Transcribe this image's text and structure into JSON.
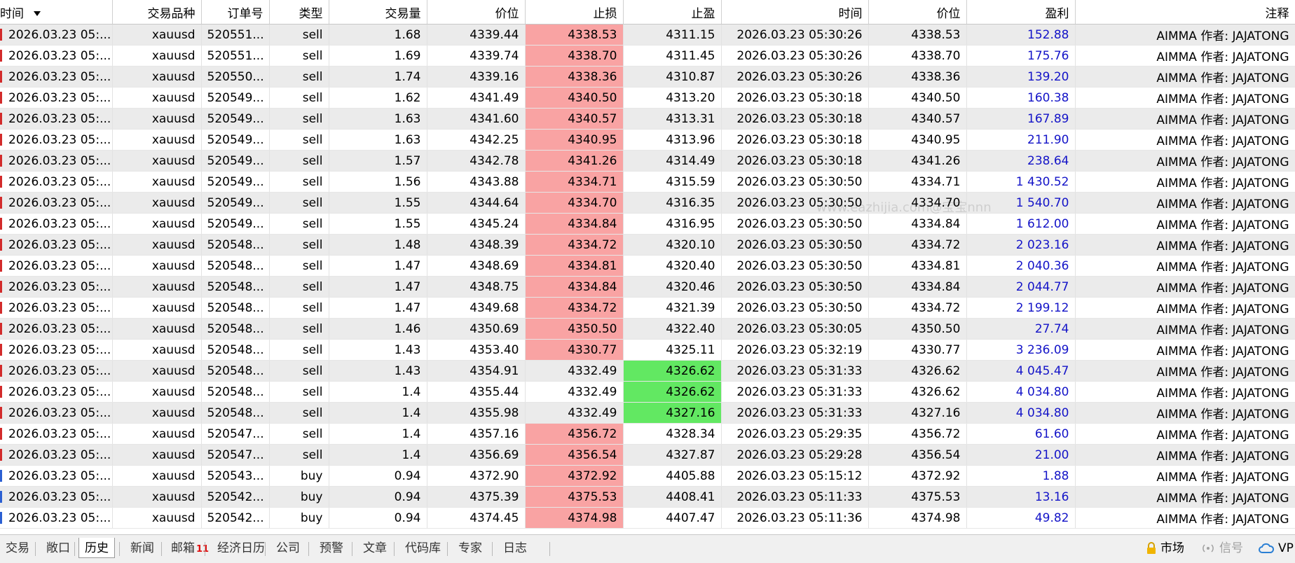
{
  "columns": [
    "时间",
    "交易品种",
    "订单号",
    "类型",
    "交易量",
    "价位",
    "止损",
    "止盈",
    "时间",
    "价位",
    "盈利",
    "注释"
  ],
  "rows": [
    {
      "open_time": "2026.03.23 05:...",
      "symbol": "xauusd",
      "ticket": "520551...",
      "type": "sell",
      "volume": "1.68",
      "open_price": "4339.44",
      "sl": "4338.53",
      "tp": "4311.15",
      "close_time": "2026.03.23 05:30:26",
      "close_price": "4338.53",
      "profit": "152.88",
      "comment": "AIMMA 作者: JAJATONG",
      "sl_hit": true,
      "tp_hit": false
    },
    {
      "open_time": "2026.03.23 05:...",
      "symbol": "xauusd",
      "ticket": "520551...",
      "type": "sell",
      "volume": "1.69",
      "open_price": "4339.74",
      "sl": "4338.70",
      "tp": "4311.45",
      "close_time": "2026.03.23 05:30:26",
      "close_price": "4338.70",
      "profit": "175.76",
      "comment": "AIMMA 作者: JAJATONG",
      "sl_hit": true,
      "tp_hit": false
    },
    {
      "open_time": "2026.03.23 05:...",
      "symbol": "xauusd",
      "ticket": "520550...",
      "type": "sell",
      "volume": "1.74",
      "open_price": "4339.16",
      "sl": "4338.36",
      "tp": "4310.87",
      "close_time": "2026.03.23 05:30:26",
      "close_price": "4338.36",
      "profit": "139.20",
      "comment": "AIMMA 作者: JAJATONG",
      "sl_hit": true,
      "tp_hit": false
    },
    {
      "open_time": "2026.03.23 05:...",
      "symbol": "xauusd",
      "ticket": "520549...",
      "type": "sell",
      "volume": "1.62",
      "open_price": "4341.49",
      "sl": "4340.50",
      "tp": "4313.20",
      "close_time": "2026.03.23 05:30:18",
      "close_price": "4340.50",
      "profit": "160.38",
      "comment": "AIMMA 作者: JAJATONG",
      "sl_hit": true,
      "tp_hit": false
    },
    {
      "open_time": "2026.03.23 05:...",
      "symbol": "xauusd",
      "ticket": "520549...",
      "type": "sell",
      "volume": "1.63",
      "open_price": "4341.60",
      "sl": "4340.57",
      "tp": "4313.31",
      "close_time": "2026.03.23 05:30:18",
      "close_price": "4340.57",
      "profit": "167.89",
      "comment": "AIMMA 作者: JAJATONG",
      "sl_hit": true,
      "tp_hit": false
    },
    {
      "open_time": "2026.03.23 05:...",
      "symbol": "xauusd",
      "ticket": "520549...",
      "type": "sell",
      "volume": "1.63",
      "open_price": "4342.25",
      "sl": "4340.95",
      "tp": "4313.96",
      "close_time": "2026.03.23 05:30:18",
      "close_price": "4340.95",
      "profit": "211.90",
      "comment": "AIMMA 作者: JAJATONG",
      "sl_hit": true,
      "tp_hit": false
    },
    {
      "open_time": "2026.03.23 05:...",
      "symbol": "xauusd",
      "ticket": "520549...",
      "type": "sell",
      "volume": "1.57",
      "open_price": "4342.78",
      "sl": "4341.26",
      "tp": "4314.49",
      "close_time": "2026.03.23 05:30:18",
      "close_price": "4341.26",
      "profit": "238.64",
      "comment": "AIMMA 作者: JAJATONG",
      "sl_hit": true,
      "tp_hit": false
    },
    {
      "open_time": "2026.03.23 05:...",
      "symbol": "xauusd",
      "ticket": "520549...",
      "type": "sell",
      "volume": "1.56",
      "open_price": "4343.88",
      "sl": "4334.71",
      "tp": "4315.59",
      "close_time": "2026.03.23 05:30:50",
      "close_price": "4334.71",
      "profit": "1 430.52",
      "comment": "AIMMA 作者: JAJATONG",
      "sl_hit": true,
      "tp_hit": false
    },
    {
      "open_time": "2026.03.23 05:...",
      "symbol": "xauusd",
      "ticket": "520549...",
      "type": "sell",
      "volume": "1.55",
      "open_price": "4344.64",
      "sl": "4334.70",
      "tp": "4316.35",
      "close_time": "2026.03.23 05:30:50",
      "close_price": "4334.70",
      "profit": "1 540.70",
      "comment": "AIMMA 作者: JAJATONG",
      "sl_hit": true,
      "tp_hit": false
    },
    {
      "open_time": "2026.03.23 05:...",
      "symbol": "xauusd",
      "ticket": "520549...",
      "type": "sell",
      "volume": "1.55",
      "open_price": "4345.24",
      "sl": "4334.84",
      "tp": "4316.95",
      "close_time": "2026.03.23 05:30:50",
      "close_price": "4334.84",
      "profit": "1 612.00",
      "comment": "AIMMA 作者: JAJATONG",
      "sl_hit": true,
      "tp_hit": false
    },
    {
      "open_time": "2026.03.23 05:...",
      "symbol": "xauusd",
      "ticket": "520548...",
      "type": "sell",
      "volume": "1.48",
      "open_price": "4348.39",
      "sl": "4334.72",
      "tp": "4320.10",
      "close_time": "2026.03.23 05:30:50",
      "close_price": "4334.72",
      "profit": "2 023.16",
      "comment": "AIMMA 作者: JAJATONG",
      "sl_hit": true,
      "tp_hit": false
    },
    {
      "open_time": "2026.03.23 05:...",
      "symbol": "xauusd",
      "ticket": "520548...",
      "type": "sell",
      "volume": "1.47",
      "open_price": "4348.69",
      "sl": "4334.81",
      "tp": "4320.40",
      "close_time": "2026.03.23 05:30:50",
      "close_price": "4334.81",
      "profit": "2 040.36",
      "comment": "AIMMA 作者: JAJATONG",
      "sl_hit": true,
      "tp_hit": false
    },
    {
      "open_time": "2026.03.23 05:...",
      "symbol": "xauusd",
      "ticket": "520548...",
      "type": "sell",
      "volume": "1.47",
      "open_price": "4348.75",
      "sl": "4334.84",
      "tp": "4320.46",
      "close_time": "2026.03.23 05:30:50",
      "close_price": "4334.84",
      "profit": "2 044.77",
      "comment": "AIMMA 作者: JAJATONG",
      "sl_hit": true,
      "tp_hit": false
    },
    {
      "open_time": "2026.03.23 05:...",
      "symbol": "xauusd",
      "ticket": "520548...",
      "type": "sell",
      "volume": "1.47",
      "open_price": "4349.68",
      "sl": "4334.72",
      "tp": "4321.39",
      "close_time": "2026.03.23 05:30:50",
      "close_price": "4334.72",
      "profit": "2 199.12",
      "comment": "AIMMA 作者: JAJATONG",
      "sl_hit": true,
      "tp_hit": false
    },
    {
      "open_time": "2026.03.23 05:...",
      "symbol": "xauusd",
      "ticket": "520548...",
      "type": "sell",
      "volume": "1.46",
      "open_price": "4350.69",
      "sl": "4350.50",
      "tp": "4322.40",
      "close_time": "2026.03.23 05:30:05",
      "close_price": "4350.50",
      "profit": "27.74",
      "comment": "AIMMA 作者: JAJATONG",
      "sl_hit": true,
      "tp_hit": false
    },
    {
      "open_time": "2026.03.23 05:...",
      "symbol": "xauusd",
      "ticket": "520548...",
      "type": "sell",
      "volume": "1.43",
      "open_price": "4353.40",
      "sl": "4330.77",
      "tp": "4325.11",
      "close_time": "2026.03.23 05:32:19",
      "close_price": "4330.77",
      "profit": "3 236.09",
      "comment": "AIMMA 作者: JAJATONG",
      "sl_hit": true,
      "tp_hit": false
    },
    {
      "open_time": "2026.03.23 05:...",
      "symbol": "xauusd",
      "ticket": "520548...",
      "type": "sell",
      "volume": "1.43",
      "open_price": "4354.91",
      "sl": "4332.49",
      "tp": "4326.62",
      "close_time": "2026.03.23 05:31:33",
      "close_price": "4326.62",
      "profit": "4 045.47",
      "comment": "AIMMA 作者: JAJATONG",
      "sl_hit": false,
      "tp_hit": true
    },
    {
      "open_time": "2026.03.23 05:...",
      "symbol": "xauusd",
      "ticket": "520548...",
      "type": "sell",
      "volume": "1.4",
      "open_price": "4355.44",
      "sl": "4332.49",
      "tp": "4326.62",
      "close_time": "2026.03.23 05:31:33",
      "close_price": "4326.62",
      "profit": "4 034.80",
      "comment": "AIMMA 作者: JAJATONG",
      "sl_hit": false,
      "tp_hit": true
    },
    {
      "open_time": "2026.03.23 05:...",
      "symbol": "xauusd",
      "ticket": "520548...",
      "type": "sell",
      "volume": "1.4",
      "open_price": "4355.98",
      "sl": "4332.49",
      "tp": "4327.16",
      "close_time": "2026.03.23 05:31:33",
      "close_price": "4327.16",
      "profit": "4 034.80",
      "comment": "AIMMA 作者: JAJATONG",
      "sl_hit": false,
      "tp_hit": true
    },
    {
      "open_time": "2026.03.23 05:...",
      "symbol": "xauusd",
      "ticket": "520547...",
      "type": "sell",
      "volume": "1.4",
      "open_price": "4357.16",
      "sl": "4356.72",
      "tp": "4328.34",
      "close_time": "2026.03.23 05:29:35",
      "close_price": "4356.72",
      "profit": "61.60",
      "comment": "AIMMA 作者: JAJATONG",
      "sl_hit": true,
      "tp_hit": false
    },
    {
      "open_time": "2026.03.23 05:...",
      "symbol": "xauusd",
      "ticket": "520547...",
      "type": "sell",
      "volume": "1.4",
      "open_price": "4356.69",
      "sl": "4356.54",
      "tp": "4327.87",
      "close_time": "2026.03.23 05:29:28",
      "close_price": "4356.54",
      "profit": "21.00",
      "comment": "AIMMA 作者: JAJATONG",
      "sl_hit": true,
      "tp_hit": false
    },
    {
      "open_time": "2026.03.23 05:...",
      "symbol": "xauusd",
      "ticket": "520543...",
      "type": "buy",
      "volume": "0.94",
      "open_price": "4372.90",
      "sl": "4372.92",
      "tp": "4405.88",
      "close_time": "2026.03.23 05:15:12",
      "close_price": "4372.92",
      "profit": "1.88",
      "comment": "AIMMA 作者: JAJATONG",
      "sl_hit": true,
      "tp_hit": false
    },
    {
      "open_time": "2026.03.23 05:...",
      "symbol": "xauusd",
      "ticket": "520542...",
      "type": "buy",
      "volume": "0.94",
      "open_price": "4375.39",
      "sl": "4375.53",
      "tp": "4408.41",
      "close_time": "2026.03.23 05:11:33",
      "close_price": "4375.53",
      "profit": "13.16",
      "comment": "AIMMA 作者: JAJATONG",
      "sl_hit": true,
      "tp_hit": false
    },
    {
      "open_time": "2026.03.23 05:...",
      "symbol": "xauusd",
      "ticket": "520542...",
      "type": "buy",
      "volume": "0.94",
      "open_price": "4374.45",
      "sl": "4374.98",
      "tp": "4407.47",
      "close_time": "2026.03.23 05:11:36",
      "close_price": "4374.98",
      "profit": "49.82",
      "comment": "AIMMA 作者: JAJATONG",
      "sl_hit": true,
      "tp_hit": false
    }
  ],
  "watermark": "www.eazhijia.com@宝宝nnn",
  "tabs": [
    {
      "label": "交易"
    },
    {
      "label": "敞口"
    },
    {
      "label": "历史",
      "active": true
    },
    {
      "label": "新闻"
    },
    {
      "label": "邮箱",
      "badge": "11"
    },
    {
      "label": "经济日历"
    },
    {
      "label": "公司"
    },
    {
      "label": "预警"
    },
    {
      "label": "文章"
    },
    {
      "label": "代码库"
    },
    {
      "label": "专家"
    },
    {
      "label": "日志"
    }
  ],
  "status": {
    "market": "市场",
    "signals": "信号",
    "vps": "VP"
  },
  "colors": {
    "sl_hit": "#f9a3a3",
    "tp_hit": "#62e862",
    "profit": "#1414c8",
    "row_alt": "#ebebeb",
    "badge": "#e01010"
  },
  "icons": {
    "market": "lock-icon",
    "signals": "signal-icon",
    "vps": "cloud-icon",
    "sort": "sort-down-icon"
  }
}
